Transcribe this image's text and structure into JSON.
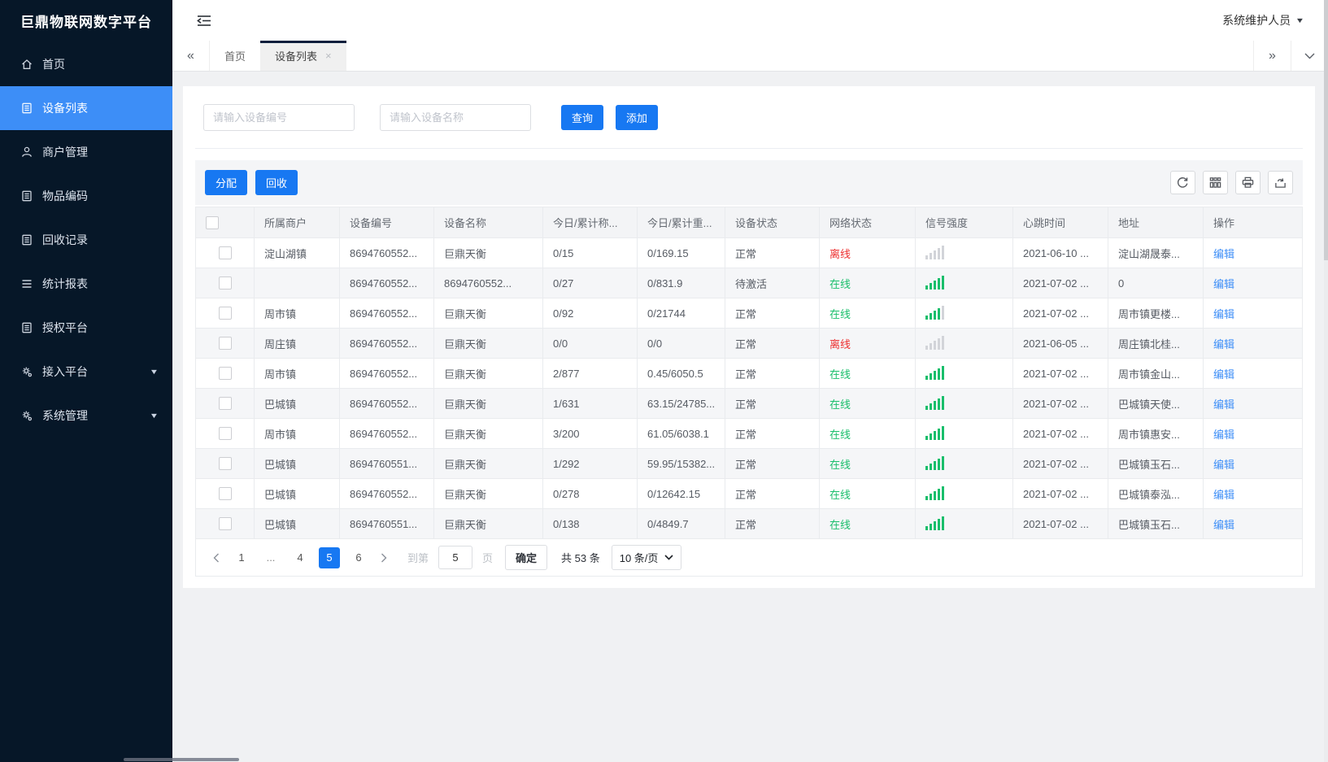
{
  "app": {
    "title": "巨鼎物联网数字平台",
    "user": "系统维护人员"
  },
  "sidebar": {
    "items": [
      {
        "icon": "home-icon",
        "label": "首页",
        "active": false,
        "expandable": false
      },
      {
        "icon": "device-list-icon",
        "label": "设备列表",
        "active": true,
        "expandable": false
      },
      {
        "icon": "merchant-icon",
        "label": "商户管理",
        "active": false,
        "expandable": false
      },
      {
        "icon": "item-code-icon",
        "label": "物品编码",
        "active": false,
        "expandable": false
      },
      {
        "icon": "recycle-record-icon",
        "label": "回收记录",
        "active": false,
        "expandable": false
      },
      {
        "icon": "report-icon",
        "label": "统计报表",
        "active": false,
        "expandable": false
      },
      {
        "icon": "auth-platform-icon",
        "label": "授权平台",
        "active": false,
        "expandable": false
      },
      {
        "icon": "access-platform-icon",
        "label": "接入平台",
        "active": false,
        "expandable": true
      },
      {
        "icon": "system-manage-icon",
        "label": "系统管理",
        "active": false,
        "expandable": true
      }
    ]
  },
  "tabs": {
    "items": [
      {
        "label": "首页",
        "active": false,
        "closable": false
      },
      {
        "label": "设备列表",
        "active": true,
        "closable": true
      }
    ],
    "close_glyph": "×"
  },
  "search": {
    "device_no_placeholder": "请输入设备编号",
    "device_name_placeholder": "请输入设备名称",
    "query_label": "查询",
    "add_label": "添加"
  },
  "toolbar": {
    "assign_label": "分配",
    "recycle_label": "回收",
    "icons": [
      "refresh",
      "column-settings",
      "print",
      "export"
    ]
  },
  "table": {
    "headers": [
      "所属商户",
      "设备编号",
      "设备名称",
      "今日/累计称...",
      "今日/累计重...",
      "设备状态",
      "网络状态",
      "信号强度",
      "心跳时间",
      "地址",
      "操作"
    ],
    "edit_label": "编辑",
    "rows": [
      {
        "merchant": "淀山湖镇",
        "device_no": "8694760552...",
        "device_name": "巨鼎天衡",
        "count": "0/15",
        "weight": "0/169.15",
        "status": "正常",
        "network": "离线",
        "online": false,
        "signal": 0,
        "heartbeat": "2021-06-10 ...",
        "address": "淀山湖晟泰..."
      },
      {
        "merchant": "",
        "device_no": "8694760552...",
        "device_name": "8694760552...",
        "count": "0/27",
        "weight": "0/831.9",
        "status": "待激活",
        "network": "在线",
        "online": true,
        "signal": 5,
        "heartbeat": "2021-07-02 ...",
        "address": "0"
      },
      {
        "merchant": "周市镇",
        "device_no": "8694760552...",
        "device_name": "巨鼎天衡",
        "count": "0/92",
        "weight": "0/21744",
        "status": "正常",
        "network": "在线",
        "online": true,
        "signal": 4,
        "heartbeat": "2021-07-02 ...",
        "address": "周市镇更楼..."
      },
      {
        "merchant": "周庄镇",
        "device_no": "8694760552...",
        "device_name": "巨鼎天衡",
        "count": "0/0",
        "weight": "0/0",
        "status": "正常",
        "network": "离线",
        "online": false,
        "signal": 0,
        "heartbeat": "2021-06-05 ...",
        "address": "周庄镇北桂..."
      },
      {
        "merchant": "周市镇",
        "device_no": "8694760552...",
        "device_name": "巨鼎天衡",
        "count": "2/877",
        "weight": "0.45/6050.5",
        "status": "正常",
        "network": "在线",
        "online": true,
        "signal": 5,
        "heartbeat": "2021-07-02 ...",
        "address": "周市镇金山..."
      },
      {
        "merchant": "巴城镇",
        "device_no": "8694760552...",
        "device_name": "巨鼎天衡",
        "count": "1/631",
        "weight": "63.15/24785...",
        "status": "正常",
        "network": "在线",
        "online": true,
        "signal": 5,
        "heartbeat": "2021-07-02 ...",
        "address": "巴城镇天使..."
      },
      {
        "merchant": "周市镇",
        "device_no": "8694760552...",
        "device_name": "巨鼎天衡",
        "count": "3/200",
        "weight": "61.05/6038.1",
        "status": "正常",
        "network": "在线",
        "online": true,
        "signal": 5,
        "heartbeat": "2021-07-02 ...",
        "address": "周市镇惠安..."
      },
      {
        "merchant": "巴城镇",
        "device_no": "8694760551...",
        "device_name": "巨鼎天衡",
        "count": "1/292",
        "weight": "59.95/15382...",
        "status": "正常",
        "network": "在线",
        "online": true,
        "signal": 5,
        "heartbeat": "2021-07-02 ...",
        "address": "巴城镇玉石..."
      },
      {
        "merchant": "巴城镇",
        "device_no": "8694760552...",
        "device_name": "巨鼎天衡",
        "count": "0/278",
        "weight": "0/12642.15",
        "status": "正常",
        "network": "在线",
        "online": true,
        "signal": 5,
        "heartbeat": "2021-07-02 ...",
        "address": "巴城镇泰泓..."
      },
      {
        "merchant": "巴城镇",
        "device_no": "8694760551...",
        "device_name": "巨鼎天衡",
        "count": "0/138",
        "weight": "0/4849.7",
        "status": "正常",
        "network": "在线",
        "online": true,
        "signal": 5,
        "heartbeat": "2021-07-02 ...",
        "address": "巴城镇玉石..."
      }
    ]
  },
  "pagination": {
    "pages": [
      "1",
      "...",
      "4",
      "5",
      "6"
    ],
    "active": "5",
    "jump_label": "到第",
    "jump_value": "5",
    "jump_unit": "页",
    "confirm_label": "确定",
    "total_label": "共 53 条",
    "page_size_label": "10 条/页"
  },
  "colors": {
    "sidebar_bg": "#061728",
    "sidebar_active": "#3d8ef7",
    "accent_blue": "#1778f2",
    "link_blue": "#3d8ef7",
    "online_green": "#19be6b",
    "offline_red": "#ed2f2f"
  }
}
